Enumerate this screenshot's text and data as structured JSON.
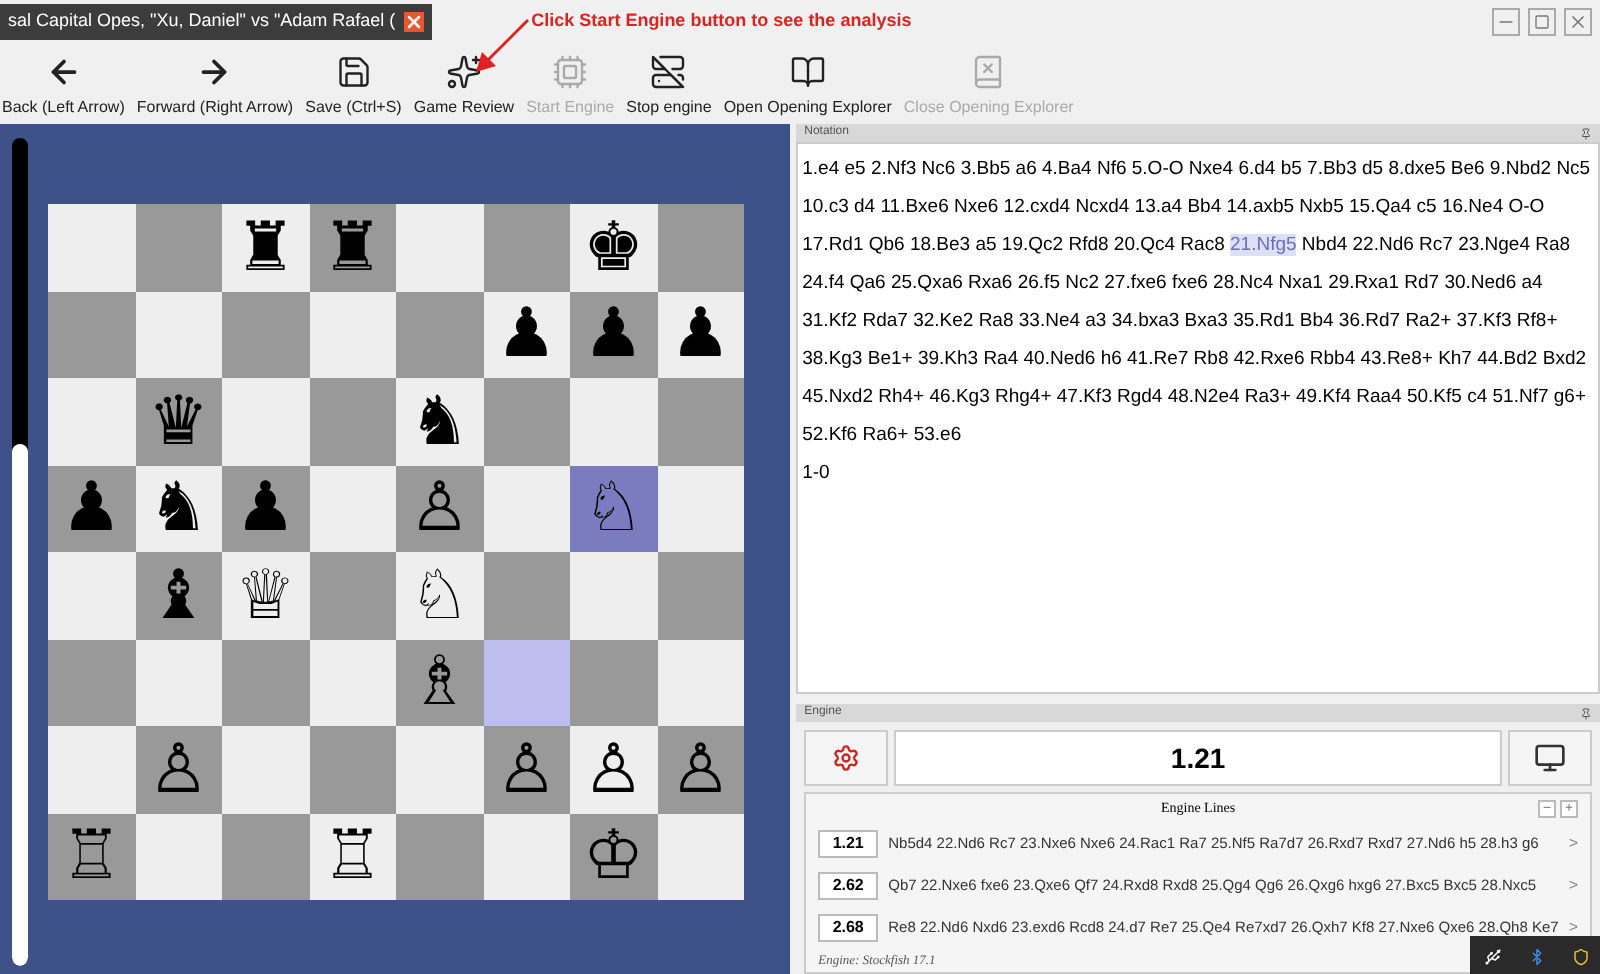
{
  "window": {
    "tab_title": "sal Capital Opes, \"Xu, Daniel\" vs \"Adam Rafael (",
    "annotation": "Click Start Engine button to see the analysis"
  },
  "toolbar": [
    {
      "label": "Back (Left Arrow)",
      "disabled": false
    },
    {
      "label": "Forward (Right Arrow)",
      "disabled": false
    },
    {
      "label": "Save (Ctrl+S)",
      "disabled": false
    },
    {
      "label": "Game Review",
      "disabled": false
    },
    {
      "label": "Start Engine",
      "disabled": true
    },
    {
      "label": "Stop engine",
      "disabled": false
    },
    {
      "label": "Open Opening Explorer",
      "disabled": false
    },
    {
      "label": "Close Opening Explorer",
      "disabled": true
    }
  ],
  "eval_bar": {
    "level": 0.63
  },
  "board": [
    [
      {
        "h": false
      },
      {
        "h": false
      },
      {
        "piece": "♜",
        "h": false
      },
      {
        "piece": "♜",
        "h": false
      },
      {
        "h": false
      },
      {
        "h": false
      },
      {
        "piece": "♚",
        "h": false
      },
      {
        "h": false
      }
    ],
    [
      {
        "h": false
      },
      {
        "h": false
      },
      {
        "h": false
      },
      {
        "h": false
      },
      {
        "h": false
      },
      {
        "piece": "♟",
        "h": false
      },
      {
        "piece": "♟",
        "h": false
      },
      {
        "piece": "♟",
        "h": false
      }
    ],
    [
      {
        "h": false
      },
      {
        "piece": "♛",
        "h": false
      },
      {
        "h": false
      },
      {
        "h": false
      },
      {
        "piece": "♞",
        "h": false
      },
      {
        "h": false
      },
      {
        "h": false
      },
      {
        "h": false
      }
    ],
    [
      {
        "piece": "♟",
        "h": false
      },
      {
        "piece": "♞",
        "h": false
      },
      {
        "piece": "♟",
        "h": false
      },
      {
        "h": false
      },
      {
        "piece": "♙",
        "h": false
      },
      {
        "h": false
      },
      {
        "piece": "♘",
        "h": true
      },
      {
        "h": false
      }
    ],
    [
      {
        "h": false
      },
      {
        "piece": "♝",
        "h": false
      },
      {
        "piece": "♕",
        "h": false
      },
      {
        "h": false
      },
      {
        "piece": "♘",
        "h": false
      },
      {
        "h": false
      },
      {
        "h": false
      },
      {
        "h": false
      }
    ],
    [
      {
        "h": false
      },
      {
        "h": false
      },
      {
        "h": false
      },
      {
        "h": false
      },
      {
        "piece": "♗",
        "h": false
      },
      {
        "h": true
      },
      {
        "h": false
      },
      {
        "h": false
      }
    ],
    [
      {
        "h": false
      },
      {
        "piece": "♙",
        "h": false
      },
      {
        "h": false
      },
      {
        "h": false
      },
      {
        "h": false
      },
      {
        "piece": "♙",
        "h": false
      },
      {
        "piece": "♙",
        "h": false
      },
      {
        "piece": "♙",
        "h": false
      }
    ],
    [
      {
        "piece": "♖",
        "h": false
      },
      {
        "h": false
      },
      {
        "h": false
      },
      {
        "piece": "♖",
        "h": false
      },
      {
        "h": false
      },
      {
        "h": false
      },
      {
        "piece": "♔",
        "h": false
      },
      {
        "h": false
      }
    ]
  ],
  "notation": {
    "title": "Notation",
    "moves": [
      {
        "text": "1.e4 e5 2.Nf3 Nc6 3.Bb5 a6 4.Ba4 Nf6 5.O-O Nxe4 6.d4 b5 7.Bb3 d5 8.dxe5 Be6 9.Nbd2 Nc5 10.c3 d4 11.Bxe6 Nxe6 12.cxd4 Ncxd4 13.a4 Bb4 14.axb5 Nxb5 15.Qa4 c5 16.Ne4 O-O 17.Rd1 Qb6 18.Be3 a5 19.Qc2 Rfd8 20.Qc4 Rac8",
        "selected": false
      },
      {
        "text": "21.Nfg5",
        "selected": true
      },
      {
        "text": "Nbd4 22.Nd6 Rc7 23.Nge4 Ra8 24.f4 Qa6 25.Qxa6 Rxa6 26.f5 Nc2 27.fxe6 fxe6 28.Nc4 Nxa1 29.Rxa1 Rd7 30.Ned6 a4 31.Kf2 Rda7 32.Ke2 Ra8 33.Ne4 a3 34.bxa3 Bxa3 35.Rd1 Bb4 36.Rd7 Ra2+ 37.Kf3 Rf8+ 38.Kg3 Be1+ 39.Kh3 Ra4 40.Ned6 h6 41.Re7 Rb8 42.Rxe6 Rbb4 43.Re8+ Kh7 44.Bd2 Bxd2 45.Nxd2 Rh4+ 46.Kg3 Rhg4+ 47.Kf3 Rgd4 48.N2e4 Ra3+ 49.Kf4 Raa4 50.Kf5 c4 51.Nf7 g6+ 52.Kf6 Ra6+ 53.e6",
        "selected": false
      }
    ],
    "result": "1-0"
  },
  "engine": {
    "title": "Engine",
    "evaluation": "1.21",
    "lines_title": "Engine Lines",
    "collapse": "−",
    "expand": "+",
    "lines": [
      {
        "score": "1.21",
        "moves": "Nb5d4 22.Nd6 Rc7 23.Nxe6 Nxe6 24.Rac1 Ra7 25.Nf5 Ra7d7 26.Rxd7 Rxd7 27.Nd6 h5 28.h3 g6",
        "more": ">"
      },
      {
        "score": "2.62",
        "moves": "Qb7 22.Nxe6 fxe6 23.Qxe6 Qf7 24.Rxd8 Rxd8 25.Qg4 Qg6 26.Qxg6 hxg6 27.Bxc5 Bxc5 28.Nxc5",
        "more": ">"
      },
      {
        "score": "2.68",
        "moves": "Re8 22.Nd6 Nxd6 23.exd6 Rcd8 24.d7 Re7 25.Qe4 Re7xd7 26.Qxh7 Kf8 27.Nxe6 Qxe6 28.Qh8 Ke7",
        "more": ">"
      }
    ],
    "footer": "Engine: Stockfish 17.1"
  }
}
